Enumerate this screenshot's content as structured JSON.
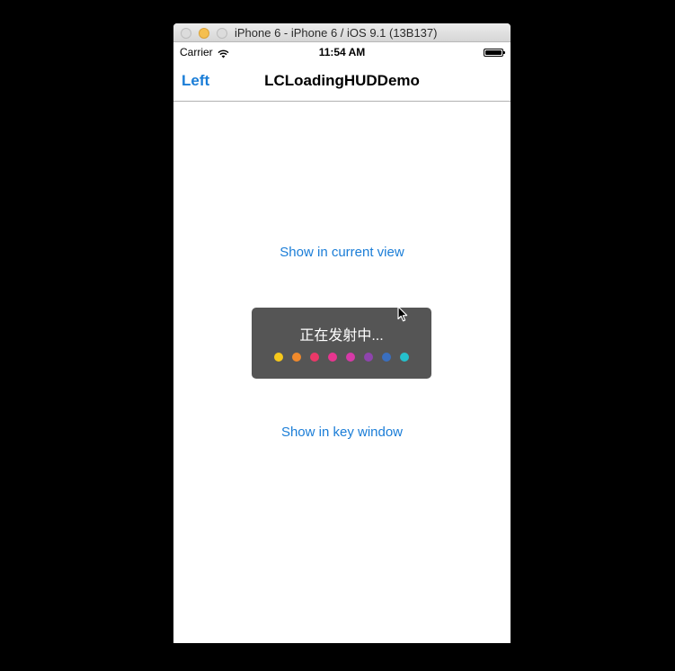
{
  "window": {
    "title": "iPhone 6 - iPhone 6 / iOS 9.1 (13B137)"
  },
  "status_bar": {
    "carrier": "Carrier",
    "time": "11:54 AM"
  },
  "nav_bar": {
    "left_button": "Left",
    "title": "LCLoadingHUDDemo"
  },
  "buttons": {
    "show_current_view": "Show in current view",
    "show_key_window": "Show in key window"
  },
  "hud": {
    "text": "正在发射中...",
    "dot_colors": [
      "#f6c81b",
      "#f08a2c",
      "#ea3868",
      "#e8358f",
      "#d63aa8",
      "#8e44ad",
      "#3a6fbf",
      "#25c0cc"
    ]
  },
  "icons": {
    "wifi": "wifi-icon",
    "battery": "battery-icon",
    "cursor": "mouse-pointer-icon"
  },
  "colors": {
    "accent": "#1a7dd7",
    "hud_background": "#555555",
    "outer_background": "#000000"
  }
}
